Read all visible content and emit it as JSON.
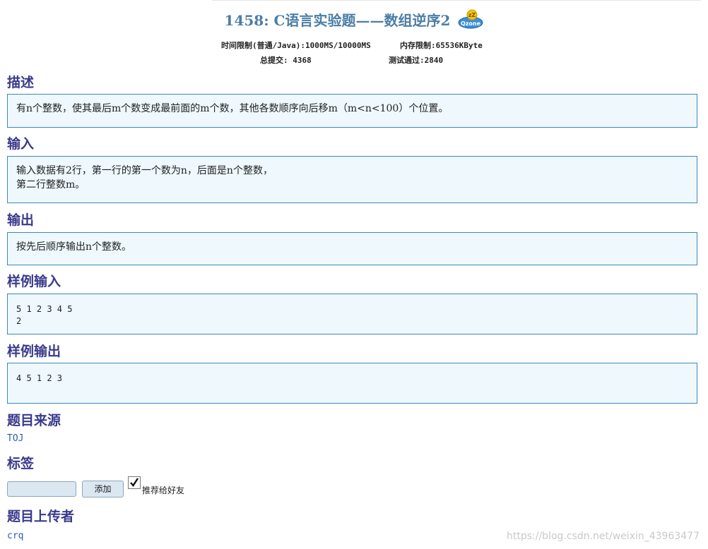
{
  "header": {
    "title": "1458: C语言实验题——数组逆序2",
    "time_limit_label": "时间限制(普通/Java):1000MS/10000MS",
    "memory_limit_label": "内存限制:65536KByte",
    "total_submit_label": "总提交: 4368",
    "accepted_label": "测试通过:2840"
  },
  "sections": {
    "description": {
      "title": "描述",
      "text": "有n个整数，使其最后m个数变成最前面的m个数，其他各数顺序向后移m（m<n<100）个位置。"
    },
    "input": {
      "title": "输入",
      "line1": "输入数据有2行，第一行的第一个数为n，后面是n个整数，",
      "line2": "第二行整数m。"
    },
    "output": {
      "title": "输出",
      "text": "按先后顺序输出n个整数。"
    },
    "sample_input": {
      "title": "样例输入",
      "line1": "5 1 2 3 4 5",
      "line2": "2"
    },
    "sample_output": {
      "title": "样例输出",
      "line1": "4 5 1 2 3"
    },
    "source": {
      "title": "题目来源",
      "link": "TOJ"
    },
    "tags": {
      "title": "标签",
      "input_value": "",
      "add_button": "添加",
      "recommend_label": "推荐给好友",
      "recommend_checked": true
    },
    "uploader": {
      "title": "题目上传者",
      "link": "crq"
    }
  },
  "watermark": "https://blog.csdn.net/weixin_43963477",
  "colors": {
    "title_blue": "#4b7ea6",
    "section_title": "#3a3a8c",
    "box_bg": "#eef8fd",
    "box_border": "#3e88b8",
    "link": "#2a5db0"
  }
}
